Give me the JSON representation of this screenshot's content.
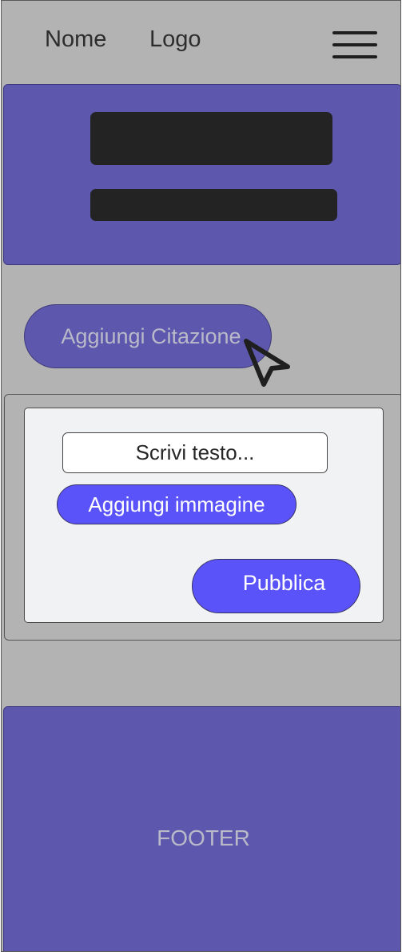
{
  "header": {
    "name": "Nome",
    "logo": "Logo",
    "menu_icon": "hamburger-menu-icon"
  },
  "hero": {
    "title_placeholder": "",
    "subtitle_placeholder": ""
  },
  "actions": {
    "add_quote_label": "Aggiungi Citazione"
  },
  "composer": {
    "text_placeholder": "Scrivi testo...",
    "add_image_label": "Aggiungi immagine",
    "publish_label": "Pubblica"
  },
  "footer": {
    "label": "FOOTER"
  },
  "colors": {
    "background": "#b3b3b3",
    "primary": "#5d58ad",
    "accent_button": "#5b53fa",
    "card": "#f1f2f4",
    "dark_block": "#232323"
  },
  "icons": {
    "cursor": "mouse-pointer-icon"
  }
}
